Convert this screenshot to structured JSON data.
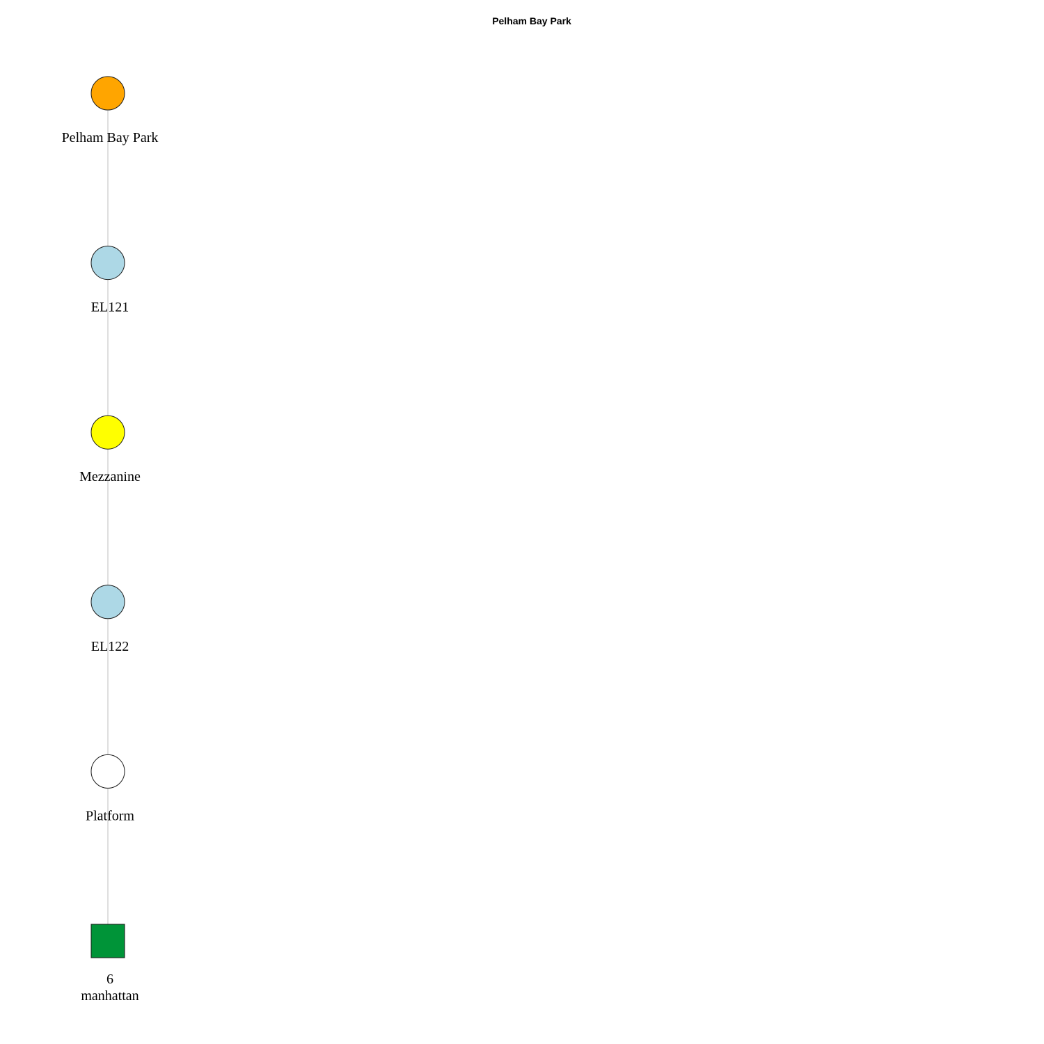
{
  "title": "Pelham Bay Park",
  "nodes": [
    {
      "id": "pelham-bay-park",
      "label_lines": [
        "Pelham Bay Park"
      ],
      "shape": "circle",
      "color": "#FFA500"
    },
    {
      "id": "el121",
      "label_lines": [
        "EL121"
      ],
      "shape": "circle",
      "color": "#ADD8E6"
    },
    {
      "id": "mezzanine",
      "label_lines": [
        "Mezzanine"
      ],
      "shape": "circle",
      "color": "#FFFF00"
    },
    {
      "id": "el122",
      "label_lines": [
        "EL122"
      ],
      "shape": "circle",
      "color": "#ADD8E6"
    },
    {
      "id": "platform",
      "label_lines": [
        "Platform"
      ],
      "shape": "circle",
      "color": "#FFFFFF"
    },
    {
      "id": "6-manhattan",
      "label_lines": [
        "6",
        "manhattan"
      ],
      "shape": "square",
      "color": "#009438"
    }
  ],
  "edges": [
    {
      "from": "pelham-bay-park",
      "to": "el121"
    },
    {
      "from": "el121",
      "to": "mezzanine"
    },
    {
      "from": "mezzanine",
      "to": "el122"
    },
    {
      "from": "el122",
      "to": "platform"
    },
    {
      "from": "platform",
      "to": "6-manhattan"
    }
  ]
}
